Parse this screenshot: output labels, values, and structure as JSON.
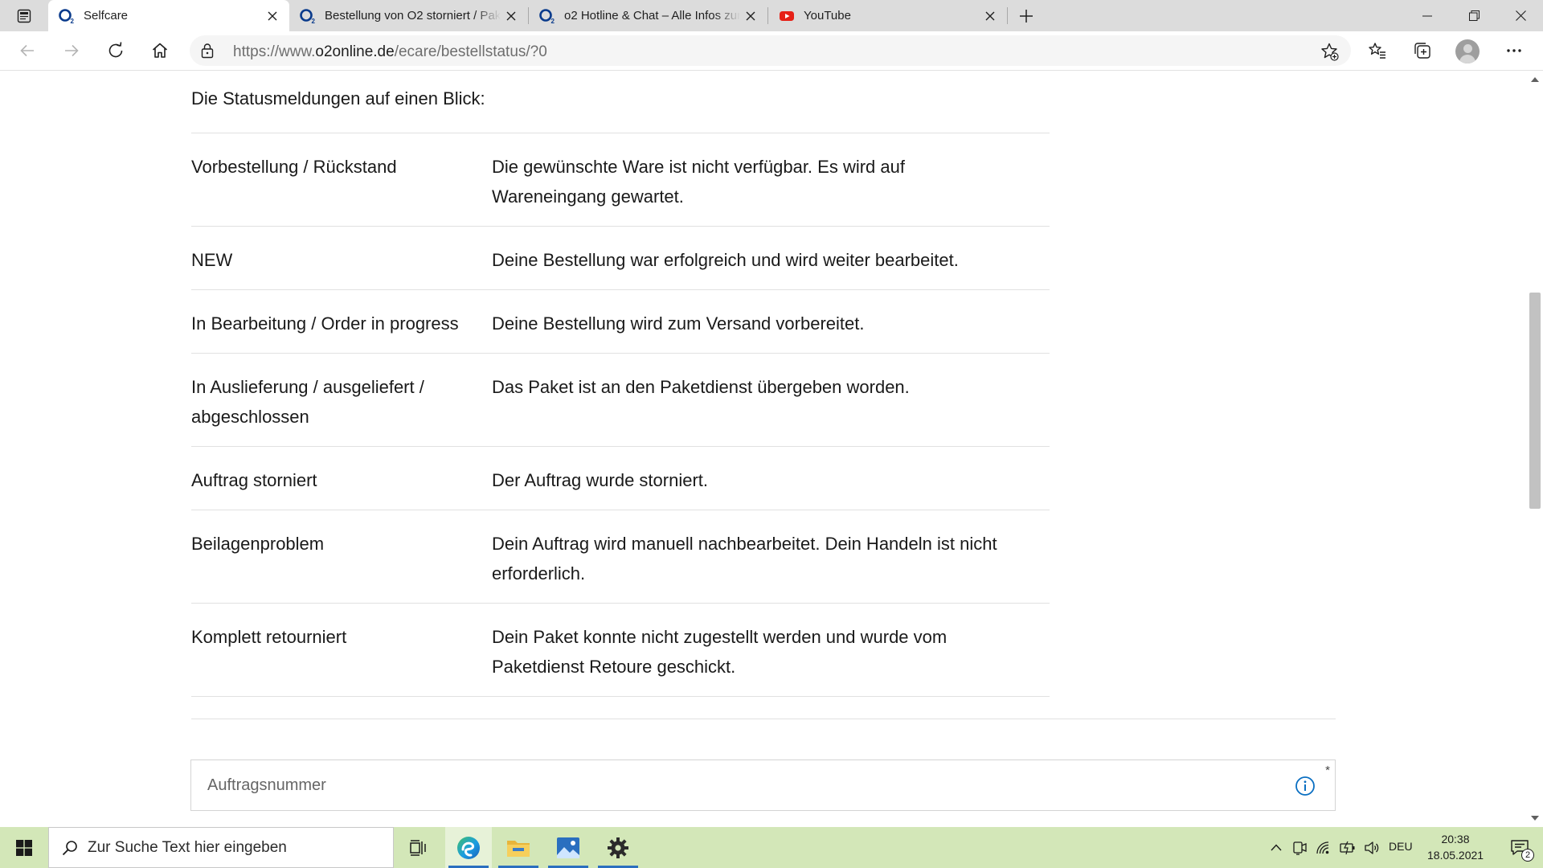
{
  "browser": {
    "tabs": [
      {
        "title": "Selfcare",
        "icon": "o2-logo-icon",
        "active": true
      },
      {
        "title": "Bestellung von O2 storniert / Paket",
        "icon": "o2-logo-icon",
        "active": false
      },
      {
        "title": "o2 Hotline & Chat – Alle Infos zur",
        "icon": "o2-logo-icon",
        "active": false
      },
      {
        "title": "YouTube",
        "icon": "youtube-icon",
        "active": false
      }
    ],
    "address": {
      "prefix": "https://www.",
      "host": "o2online.de",
      "path": "/ecare/bestellstatus/?0"
    }
  },
  "page": {
    "intro": "Die Statusmeldungen auf einen Blick:",
    "statuses": [
      {
        "label": "Vorbestellung / Rückstand",
        "description": "Die gewünschte Ware ist nicht verfügbar. Es wird auf Wareneingang gewartet."
      },
      {
        "label": "NEW",
        "description": "Deine Bestellung war erfolgreich und wird weiter bearbeitet."
      },
      {
        "label": "In Bearbeitung / Order in progress",
        "description": "Deine Bestellung wird zum Versand vorbereitet."
      },
      {
        "label": "In Auslieferung / ausgeliefert / abgeschlossen",
        "description": "Das Paket ist an den Paketdienst übergeben worden."
      },
      {
        "label": "Auftrag storniert",
        "description": "Der Auftrag wurde storniert."
      },
      {
        "label": "Beilagenproblem",
        "description": "Dein Auftrag wird manuell nachbearbeitet. Dein Handeln ist nicht erforderlich."
      },
      {
        "label": "Komplett retourniert",
        "description": "Dein Paket konnte nicht zugestellt werden und wurde vom Paketdienst Retoure geschickt."
      }
    ],
    "order_field": {
      "placeholder": "Auftragsnummer",
      "required_mark": "*"
    }
  },
  "taskbar": {
    "search_placeholder": "Zur Suche Text hier eingeben",
    "language": "DEU",
    "time": "20:38",
    "date": "18.05.2021",
    "notification_count": "2"
  },
  "colors": {
    "o2_blue": "#0a3b8c",
    "youtube_red": "#e62117",
    "taskbar_bg": "#d3e7b8",
    "edge_blue": "#1b7fd6",
    "edge_green": "#3fbf6b"
  }
}
